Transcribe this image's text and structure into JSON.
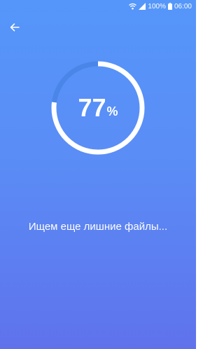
{
  "status_bar": {
    "battery_percent": "100%",
    "time": "06:00",
    "icons": [
      "wifi-icon",
      "signal-icon",
      "battery-icon"
    ]
  },
  "toolbar": {
    "back_icon": "arrow-left-icon"
  },
  "scan": {
    "progress_value": "77",
    "progress_unit": "%",
    "progress_fraction": 0.77,
    "message": "Ищем еще лишние файлы..."
  },
  "colors": {
    "background_top": "#5596fa",
    "background_bottom": "#5f72ec",
    "ring_progress": "#ffffff",
    "ring_track": "#4a86e8",
    "text": "#ffffff"
  }
}
